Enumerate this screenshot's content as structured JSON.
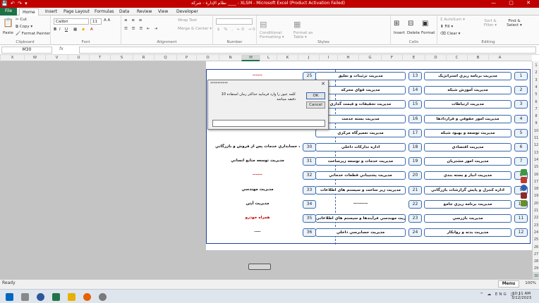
{
  "app": {
    "title": "Microsoft Excel (Product Activation Failed)",
    "title_prefix": "نظام الإدارة - شركة ____ - XLSM",
    "quick_access": "💾 ↶ ↷ ▾",
    "window_controls": "— ▢ ✕"
  },
  "tabs": {
    "file": "File",
    "home": "Home",
    "insert": "Insert",
    "page_layout": "Page Layout",
    "formulas": "Formulas",
    "data": "Data",
    "review": "Review",
    "view": "View",
    "developer": "Developer"
  },
  "ribbon": {
    "clipboard": {
      "label": "Clipboard",
      "paste": "Paste",
      "cut": "Cut",
      "copy": "Copy ▾",
      "format_painter": "Format Painter"
    },
    "font": {
      "label": "Font",
      "name": "Calibri",
      "size": "11"
    },
    "alignment": {
      "label": "Alignment",
      "wrap": "Wrap Text",
      "merge": "Merge & Center ▾"
    },
    "number": {
      "label": "Number"
    },
    "styles": {
      "label": "Styles",
      "conditional": "Conditional Formatting ▾",
      "format_table": "Format as Table ▾"
    },
    "cells": {
      "label": "Cells",
      "insert": "Insert",
      "delete": "Delete",
      "format": "Format"
    },
    "editing": {
      "label": "Editing",
      "autosum": "AutoSum ▾",
      "fill": "Fill ▾",
      "clear": "Clear ▾",
      "sort": "Sort & Filter ▾",
      "find": "Find & Select ▾"
    }
  },
  "formula_bar": {
    "name_box": "M30",
    "fx": "fx",
    "value": ""
  },
  "columns": [
    "X",
    "W",
    "V",
    "U",
    "T",
    "S",
    "R",
    "Q",
    "P",
    "O",
    "N",
    "M",
    "L",
    "K",
    "J",
    "I",
    "H",
    "G",
    "F",
    "E",
    "D",
    "C",
    "B",
    "A"
  ],
  "rows": [
    "1",
    "2",
    "3",
    "4",
    "5",
    "6",
    "7",
    "8",
    "9",
    "10",
    "11",
    "12",
    "13",
    "14",
    "15",
    "16",
    "17",
    "18",
    "19",
    "20",
    "21",
    "22",
    "23",
    "24",
    "25",
    "26",
    "27",
    "28",
    "29",
    "30"
  ],
  "selected": {
    "column": "M",
    "row": "30"
  },
  "items": [
    {
      "n": "1",
      "t": "مديريت برنامه ريزي استراتژيک"
    },
    {
      "n": "2",
      "t": "مديريت آموزش شبکه"
    },
    {
      "n": "3",
      "t": "مديريت ارتباطات"
    },
    {
      "n": "4",
      "t": "مديريت امور حقوقي و قراردادها"
    },
    {
      "n": "5",
      "t": "مديريت توسعه و بهبود شبكه"
    },
    {
      "n": "6",
      "t": "مديريت اقتصادي"
    },
    {
      "n": "7",
      "t": "مديريت امور مشتريان"
    },
    {
      "n": "8",
      "t": "مديريت انبار و بسته بندي"
    },
    {
      "n": "9",
      "t": "اداره كنترل و پايش گزارشات بازرگاني"
    },
    {
      "n": "10",
      "t": "مديريت برنامه ريزي جامع"
    },
    {
      "n": "11",
      "t": "مديريت بازرسي"
    },
    {
      "n": "12",
      "t": "مديريت بدنه و روانكار"
    },
    {
      "n": "13",
      "t": "مديريت تزئينات و تعليق"
    },
    {
      "n": "14",
      "t": "مديريت قواي محركه"
    },
    {
      "n": "15",
      "t": "مديريت تحقيقات و قيمت گذاري"
    },
    {
      "n": "16",
      "t": "مديريت بسته خدمت"
    },
    {
      "n": "17",
      "t": "مديريت تعميرگاه مركزي"
    },
    {
      "n": "18",
      "t": "اداره تداركات داخلي"
    },
    {
      "n": "19",
      "t": "مديريت خدمات و توسعه زيرساخت"
    },
    {
      "n": "20",
      "t": "مديريت پشتيباني قطعات خدماتي"
    },
    {
      "n": "21",
      "t": "مديريت زير ساخت و سيستم هاي اطلاعات"
    },
    {
      "n": "22",
      "t": "---------"
    },
    {
      "n": "23",
      "t": "مديريت مهندسي فرآيندها و سيستم هاي اطلاعاتي"
    },
    {
      "n": "24",
      "t": "مديريت حسابرسي داخلي"
    },
    {
      "n": "25",
      "t": "------"
    },
    {
      "n": "26",
      "t": ""
    },
    {
      "n": "27",
      "t": ""
    },
    {
      "n": "28",
      "t": ""
    },
    {
      "n": "29",
      "t": ""
    },
    {
      "n": "30",
      "t": "مديريت حسابداري خدمات پس از فروش و بازرگاني"
    },
    {
      "n": "31",
      "t": "مديريت توسعه منابع انساني"
    },
    {
      "n": "32",
      "t": "------"
    },
    {
      "n": "33",
      "t": "مديريت مهندسي"
    },
    {
      "n": "34",
      "t": "مديريت آپتن"
    },
    {
      "n": "35",
      "t": "همراه خودرو"
    },
    {
      "n": "36",
      "t": "----"
    }
  ],
  "dialog": {
    "title": "**********",
    "message": "كلمه عبور را وارد فرماييد حداكثر زمان استفاده 10 دقيقه ميباشد",
    "ok": "OK",
    "cancel": "Cancel",
    "close": "✕",
    "input_value": ""
  },
  "status": {
    "ready": "Ready",
    "sheet_tab": "Menu",
    "zoom": "100%"
  },
  "taskbar": {
    "tray": "^ ☁ ENG ◫ ♪",
    "time": "10:11 AM",
    "date": "3/12/2023"
  },
  "colors": {
    "excel_green": "#217346",
    "titlebar_red": "#c00000",
    "form_border": "#1f3f9f",
    "red_text": "#c00000"
  }
}
